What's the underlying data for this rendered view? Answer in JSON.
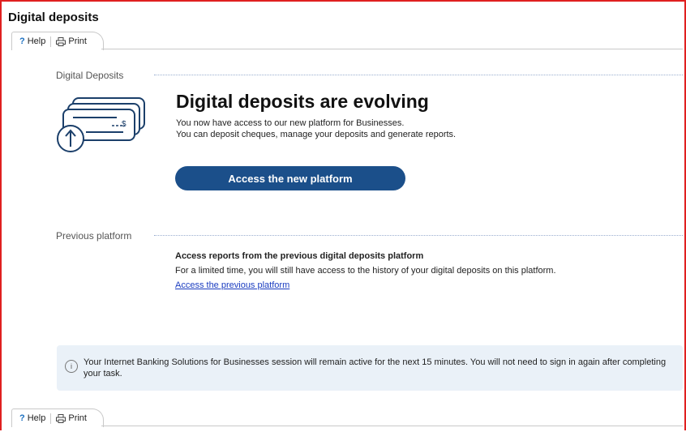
{
  "page": {
    "title": "Digital deposits"
  },
  "toolbar": {
    "help_label": "Help",
    "print_label": "Print"
  },
  "section_digital": {
    "label": "Digital Deposits",
    "heading": "Digital deposits are evolving",
    "line1": "You now have access to our new platform for Businesses.",
    "line2": "You can deposit cheques, manage your deposits and generate reports.",
    "cta_label": "Access the new platform",
    "icon": "cheque-upload-icon",
    "icon_currency": "$"
  },
  "section_previous": {
    "label": "Previous platform",
    "heading": "Access reports from the previous digital deposits platform",
    "line1": "For a limited time, you will still have access to the history of your digital deposits on this platform.",
    "link_label": "Access the previous platform"
  },
  "notice": {
    "text": "Your Internet Banking Solutions for Businesses session will remain active for the next 15 minutes. You will not need to sign in again after completing your task.",
    "icon": "info-icon"
  },
  "colors": {
    "frame_border": "#e02020",
    "cta_bg": "#1b4f8a",
    "link": "#1a3cc0",
    "notice_bg": "#eaf1f8"
  }
}
